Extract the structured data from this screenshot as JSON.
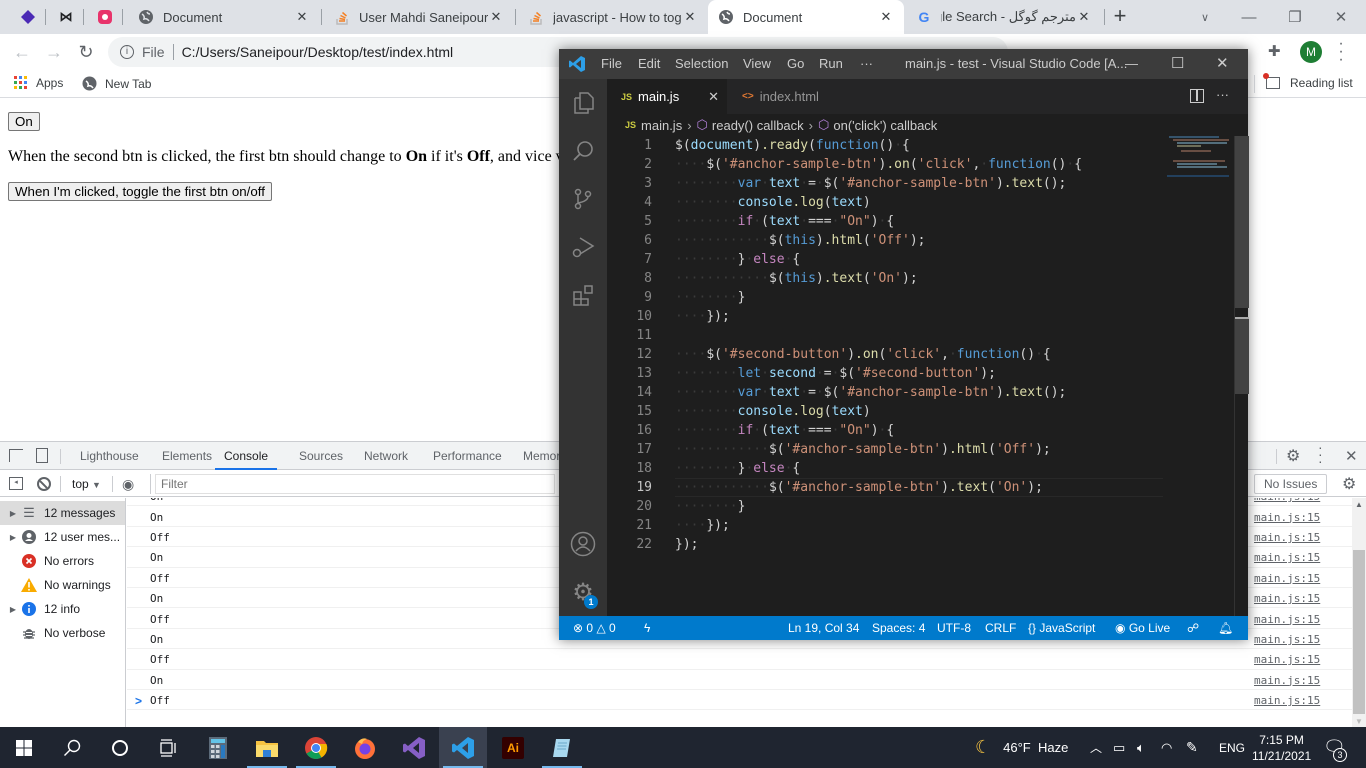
{
  "chrome": {
    "tabs": [
      {
        "title": "Document",
        "icon": "globe-icon",
        "active": false
      },
      {
        "title": "User Mahdi Saneipour - ",
        "icon": "stackoverflow-icon",
        "active": false
      },
      {
        "title": "javascript - How to togg",
        "icon": "stackoverflow-icon",
        "active": false
      },
      {
        "title": "Document",
        "icon": "globe-icon",
        "active": true
      },
      {
        "title": "مترجم گوگل - Google Search",
        "icon": "google-icon",
        "active": false
      }
    ],
    "new_tab": "+",
    "address": {
      "scheme_label": "File",
      "url": "C:/Users/Saneipour/Desktop/test/index.html"
    },
    "profile_initial": "M",
    "bookmarks": [
      {
        "label": "Apps",
        "icon": "apps-grid-icon"
      },
      {
        "label": "New Tab",
        "icon": "globe-icon"
      }
    ],
    "reading_list": "Reading list"
  },
  "page": {
    "first_button": "On",
    "para_prefix": "When the second btn is clicked, the first btn should change to ",
    "para_on": "On",
    "para_mid": " if it's ",
    "para_off": "Off",
    "para_suffix": ", and vice versa.",
    "second_button": "When I'm clicked, toggle the first btn on/off"
  },
  "devtools": {
    "tabs": [
      "Lighthouse",
      "Elements",
      "Console",
      "Sources",
      "Network",
      "Performance",
      "Memory"
    ],
    "active_tab": "Console",
    "context": "top",
    "filter_placeholder": "Filter",
    "issues": "No Issues",
    "sidebar": [
      {
        "label": "12 messages",
        "icon": "list-icon",
        "expandable": true,
        "selected": true
      },
      {
        "label": "12 user mes...",
        "icon": "user-icon",
        "expandable": true
      },
      {
        "label": "No errors",
        "icon": "error-icon"
      },
      {
        "label": "No warnings",
        "icon": "warning-icon"
      },
      {
        "label": "12 info",
        "icon": "info-icon",
        "expandable": true
      },
      {
        "label": "No verbose",
        "icon": "bug-icon"
      }
    ],
    "log": [
      {
        "msg": "On",
        "src": "main.js:15"
      },
      {
        "msg": "Off",
        "src": "main.js:15"
      },
      {
        "msg": "On",
        "src": "main.js:15"
      },
      {
        "msg": "Off",
        "src": "main.js:15"
      },
      {
        "msg": "On",
        "src": "main.js:15"
      },
      {
        "msg": "Off",
        "src": "main.js:15"
      },
      {
        "msg": "On",
        "src": "main.js:15"
      },
      {
        "msg": "Off",
        "src": "main.js:15"
      },
      {
        "msg": "On",
        "src": "main.js:15"
      },
      {
        "msg": "Off",
        "src": "main.js:15"
      }
    ],
    "prompt": ">"
  },
  "vscode": {
    "menu": [
      "File",
      "Edit",
      "Selection",
      "View",
      "Go",
      "Run",
      "···"
    ],
    "title": "main.js - test - Visual Studio Code [A...",
    "tabs": [
      {
        "label": "main.js",
        "icon": "JS",
        "active": true
      },
      {
        "label": "index.html",
        "icon": "<>",
        "active": false
      }
    ],
    "breadcrumb": [
      "main.js",
      "ready() callback",
      "on('click') callback"
    ],
    "settings_badge": "1",
    "code": [
      "$(document).ready(function() {",
      "    $('#anchor-sample-btn').on('click', function() {",
      "        var text = $('#anchor-sample-btn').text();",
      "        console.log(text)",
      "        if (text === \"On\") {",
      "            $(this).html('Off');",
      "        } else {",
      "            $(this).text('On');",
      "        }",
      "    });",
      "",
      "    $('#second-button').on('click', function() {",
      "        let second = $('#second-button');",
      "        var text = $('#anchor-sample-btn').text();",
      "        console.log(text)",
      "        if (text === \"On\") {",
      "            $('#anchor-sample-btn').html('Off');",
      "        } else {",
      "            $('#anchor-sample-btn').text('On');",
      "        }",
      "    });",
      "});"
    ],
    "current_line": 19,
    "status": {
      "errors": "0",
      "warnings": "0",
      "position": "Ln 19, Col 34",
      "spaces": "Spaces: 4",
      "encoding": "UTF-8",
      "eol": "CRLF",
      "language": "JavaScript",
      "golive": "Go Live"
    }
  },
  "taskbar": {
    "apps": [
      "calculator",
      "file-explorer",
      "chrome",
      "firefox",
      "visual-studio",
      "vscode",
      "illustrator",
      "notepad"
    ],
    "weather": "46°F  Haze",
    "lang": "ENG",
    "time": "7:15 PM",
    "date": "11/21/2021",
    "notifications": "3"
  }
}
